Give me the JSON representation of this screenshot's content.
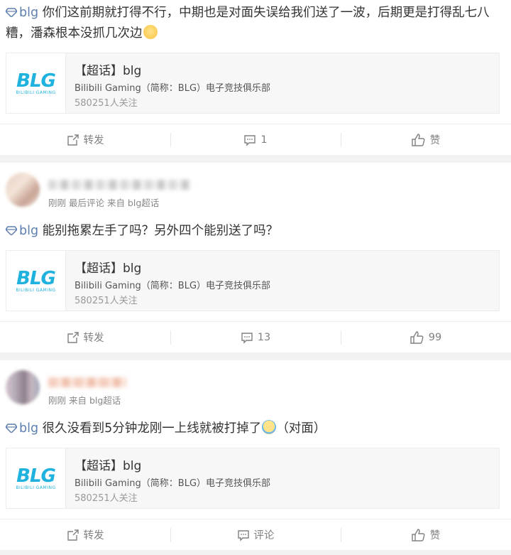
{
  "colors": {
    "link_blue": "#5d7fae",
    "brand_cyan": "#1fb2df",
    "gray_text": "#888888"
  },
  "posts": [
    {
      "text_prefix": "blg",
      "text": "你们这前期就打得不行，中期也是对面失误给我们送了一波，后期更是打得乱七八糟，潘森根本没抓几次边",
      "emoji": "smile-emoji",
      "embed": {
        "title": "【超话】blg",
        "desc": "Bilibili Gaming（简称：BLG）电子竞技俱乐部",
        "fans": "580251人关注",
        "logo_big": "BLG",
        "logo_small": "BILIBILI GAMING"
      },
      "actions": {
        "repost": "转发",
        "comment": "1",
        "like": "赞"
      }
    },
    {
      "meta": "刚刚 最后评论 来自 blg超话",
      "text_prefix": "blg",
      "text": "能别拖累左手了吗？另外四个能别送了吗？",
      "embed": {
        "title": "【超话】blg",
        "desc": "Bilibili Gaming（简称：BLG）电子竞技俱乐部",
        "fans": "580251人关注",
        "logo_big": "BLG",
        "logo_small": "BILIBILI GAMING"
      },
      "actions": {
        "repost": "转发",
        "comment": "13",
        "like": "99"
      }
    },
    {
      "meta": "刚刚 来自 blg超话",
      "text_prefix": "blg",
      "text_a": "很久没看到5分钟龙刚一上线就被打掉了",
      "text_b": "（对面）",
      "emoji": "laugh-cry-emoji",
      "embed": {
        "title": "【超话】blg",
        "desc": "Bilibili Gaming（简称：BLG）电子竞技俱乐部",
        "fans": "580251人关注",
        "logo_big": "BLG",
        "logo_small": "BILIBILI GAMING"
      },
      "actions": {
        "repost": "转发",
        "comment": "评论",
        "like": "赞"
      }
    }
  ]
}
